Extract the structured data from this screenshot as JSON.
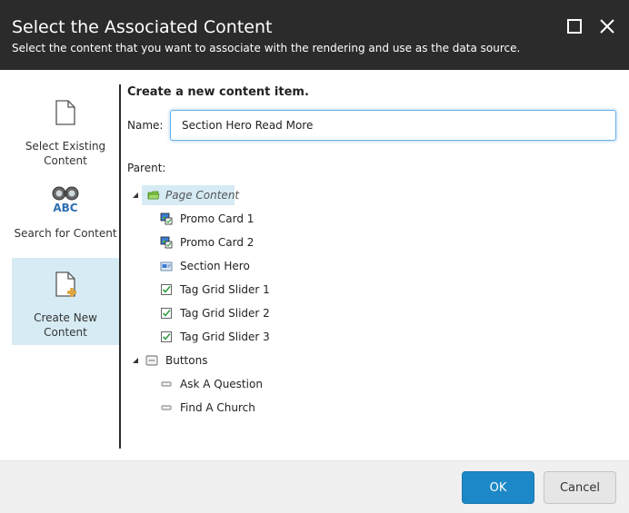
{
  "dialog": {
    "title": "Select the Associated Content",
    "subtitle": "Select the content that you want to associate with the rendering and use as the data source."
  },
  "sidebar": {
    "items": [
      {
        "label": "Select Existing Content",
        "icon": "document-icon",
        "active": false
      },
      {
        "label": "Search for Content",
        "icon": "binoculars-abc-icon",
        "active": false
      },
      {
        "label": "Create New Content",
        "icon": "new-document-icon",
        "active": true
      }
    ]
  },
  "main": {
    "section_title": "Create a new content item.",
    "name_label": "Name:",
    "name_value": "Section Hero Read More",
    "parent_label": "Parent:"
  },
  "tree": {
    "page_content": {
      "label": "Page Content",
      "icon": "folder-icon",
      "expanded": true,
      "selected": true
    },
    "page_children": [
      {
        "label": "Promo Card 1",
        "icon": "promo-card-icon"
      },
      {
        "label": "Promo Card 2",
        "icon": "promo-card-icon"
      },
      {
        "label": "Section Hero",
        "icon": "section-hero-icon"
      },
      {
        "label": "Tag Grid Slider 1",
        "icon": "checkbox-icon"
      },
      {
        "label": "Tag Grid Slider 2",
        "icon": "checkbox-icon"
      },
      {
        "label": "Tag Grid Slider 3",
        "icon": "checkbox-icon"
      }
    ],
    "buttons": {
      "label": "Buttons",
      "icon": "buttons-folder-icon",
      "expanded": true
    },
    "button_children": [
      {
        "label": "Ask A Question",
        "icon": "button-icon"
      },
      {
        "label": "Find A Church",
        "icon": "button-icon"
      }
    ]
  },
  "footer": {
    "ok_label": "OK",
    "cancel_label": "Cancel"
  },
  "colors": {
    "header_bg": "#2b2b2b",
    "accent": "#1c88c7",
    "selection": "#d6ebf4"
  }
}
